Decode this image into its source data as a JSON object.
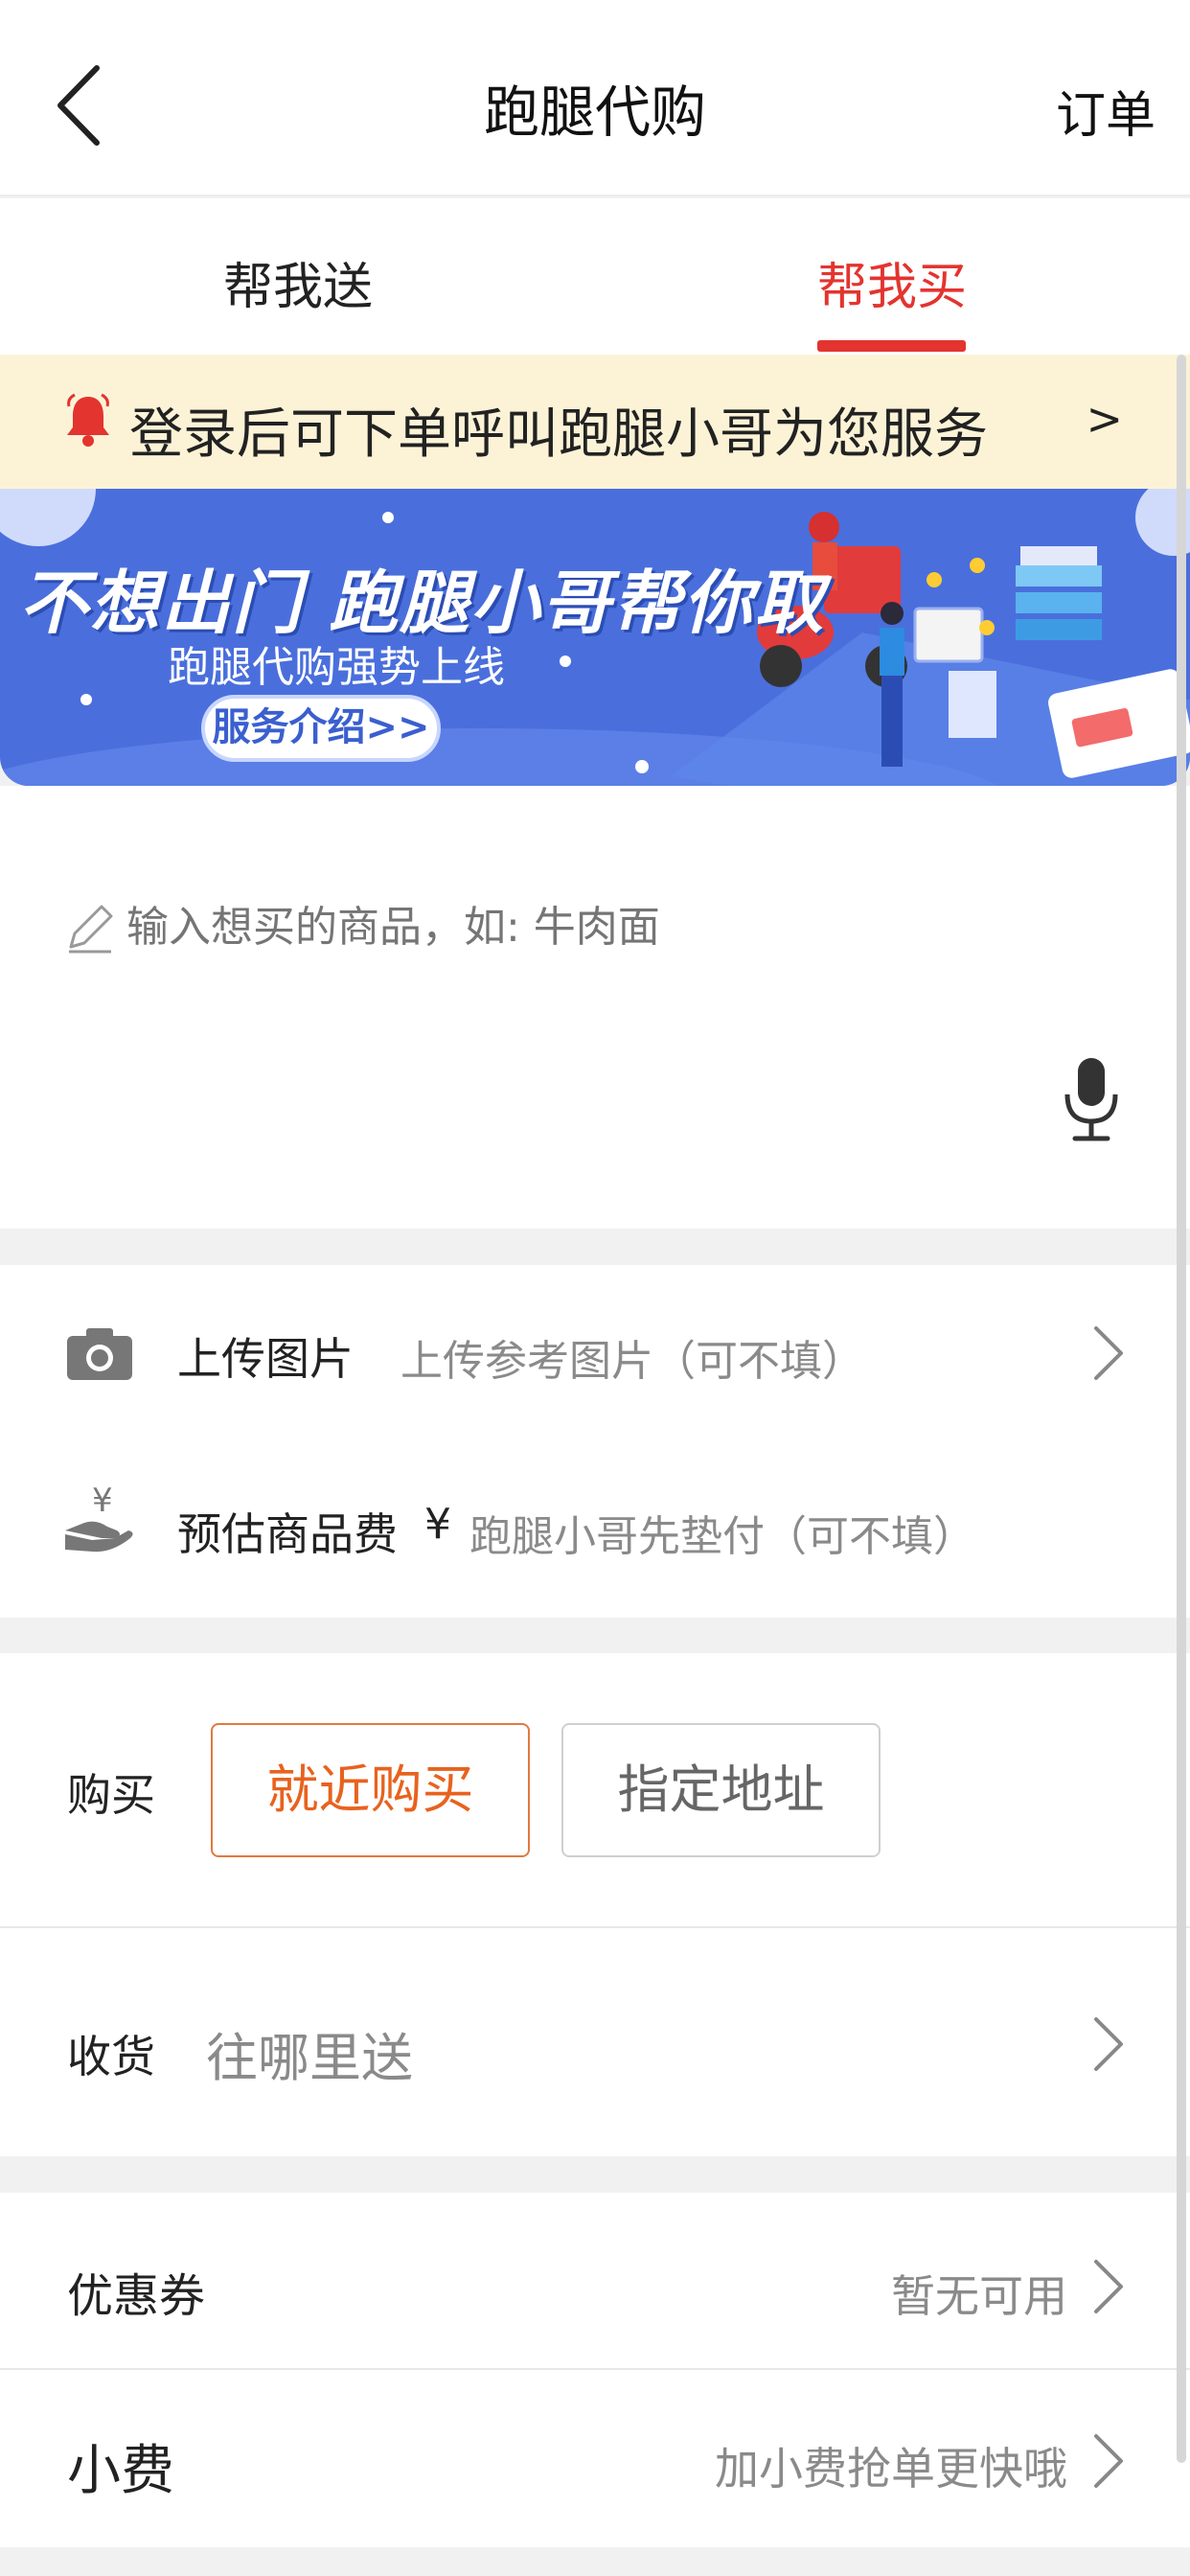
{
  "nav": {
    "title": "跑腿代购",
    "orders_label": "订单"
  },
  "tabs": [
    {
      "label": "帮我送",
      "active": false
    },
    {
      "label": "帮我买",
      "active": true
    }
  ],
  "notice": {
    "text": "登录后可下单呼叫跑腿小哥为您服务",
    "arrow": ">"
  },
  "banner": {
    "headline": "不想出门 跑腿小哥帮你取",
    "subtitle": "跑腿代购强势上线",
    "button_label": "服务介绍>>"
  },
  "input": {
    "placeholder": "输入想买的商品，如: 牛肉面"
  },
  "upload": {
    "label": "上传图片",
    "placeholder": "上传参考图片（可不填）"
  },
  "fee": {
    "label": "预估商品费",
    "currency": "¥",
    "placeholder": "跑腿小哥先垫付（可不填）"
  },
  "purchase": {
    "label": "购买",
    "options": [
      {
        "label": "就近购买",
        "selected": true
      },
      {
        "label": "指定地址",
        "selected": false
      }
    ]
  },
  "receive": {
    "label": "收货",
    "placeholder": "往哪里送"
  },
  "coupon": {
    "label": "优惠券",
    "value": "暂无可用"
  },
  "tip": {
    "label": "小费",
    "value": "加小费抢单更快哦"
  },
  "colors": {
    "accent": "#e3342f",
    "selected_option": "#e8621e",
    "banner": "#4a6fdc",
    "notice_bg": "#fcf3d7"
  }
}
